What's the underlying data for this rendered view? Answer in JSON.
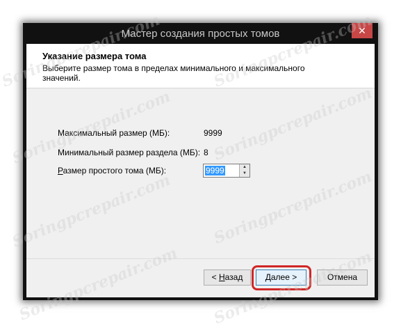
{
  "window": {
    "title": "Мастер создания простых томов",
    "close_glyph": "✕"
  },
  "header": {
    "title": "Указание размера тома",
    "description": "Выберите размер тома в пределах минимального и максимального значений."
  },
  "fields": {
    "max_label": "Максимальный размер (МБ):",
    "max_value": "9999",
    "min_label": "Минимальный размер раздела (МБ):",
    "min_value": "8",
    "size_label": "Размер простого тома (МБ):",
    "size_value": "9999"
  },
  "buttons": {
    "back_prefix": "< ",
    "back_underlined": "Н",
    "back_rest": "азад",
    "next_underlined": "Д",
    "next_rest": "алее >",
    "cancel": "Отмена"
  },
  "watermark": "Soringpcrepair.com",
  "accent": {
    "highlight": "#d02626",
    "selection": "#3399ff",
    "close": "#c74747"
  }
}
